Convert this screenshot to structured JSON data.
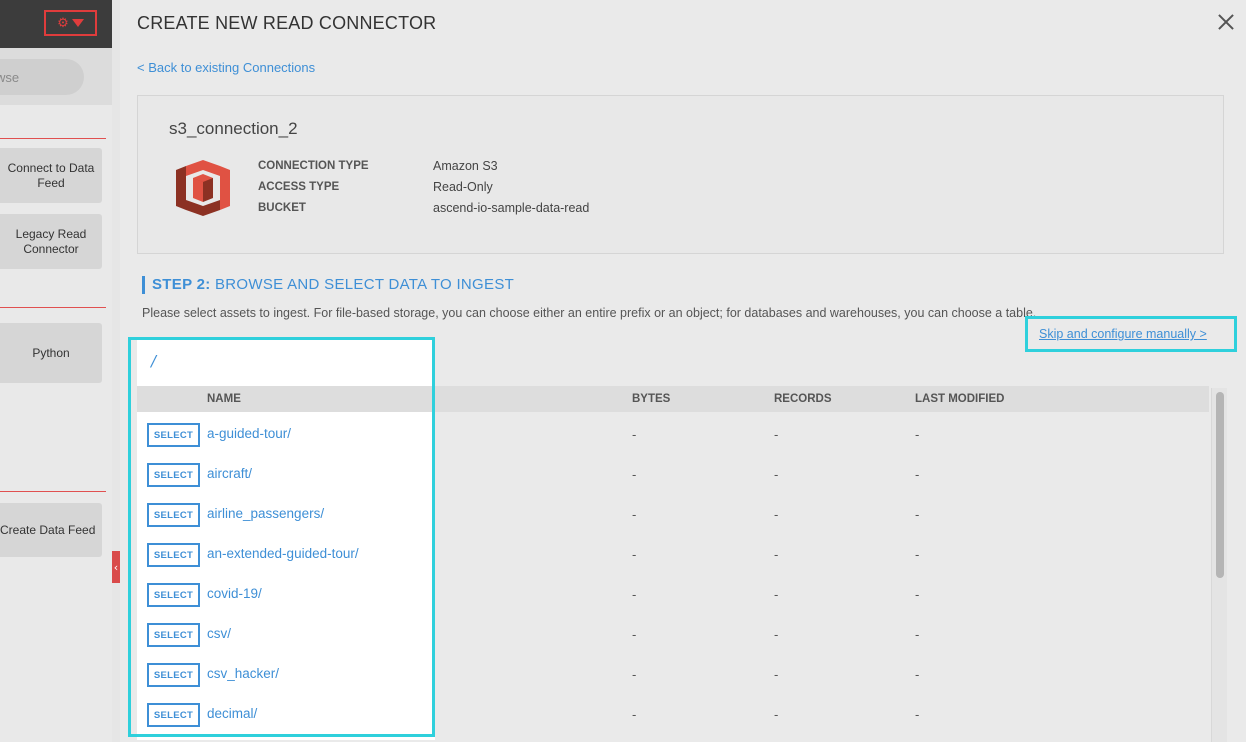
{
  "sidebar": {
    "browse_label": "wse",
    "buttons": {
      "connect": "Connect to Data Feed",
      "legacy": "Legacy Read Connector",
      "python": "Python",
      "create_feed": "Create Data Feed"
    },
    "collapse_glyph": "‹"
  },
  "panel": {
    "title": "CREATE NEW READ CONNECTOR",
    "back_link": "< Back to existing Connections"
  },
  "connection": {
    "name": "s3_connection_2",
    "icon": "amazon-s3-icon",
    "fields": [
      {
        "key": "CONNECTION TYPE",
        "value": "Amazon S3"
      },
      {
        "key": "ACCESS TYPE",
        "value": "Read-Only"
      },
      {
        "key": "BUCKET",
        "value": "ascend-io-sample-data-read"
      }
    ]
  },
  "step": {
    "prefix": "STEP 2:",
    "title": "BROWSE AND SELECT DATA TO INGEST",
    "description": "Please select assets to ingest. For file-based storage, you can choose either an entire prefix or an object; for databases and warehouses, you can choose a table.",
    "skip_link": "Skip and configure manually >"
  },
  "browser": {
    "path": "/",
    "columns": {
      "name": "NAME",
      "bytes": "BYTES",
      "records": "RECORDS",
      "last_modified": "LAST MODIFIED"
    },
    "select_label": "SELECT",
    "rows": [
      {
        "name": "a-guided-tour/",
        "bytes": "-",
        "records": "-",
        "last_modified": "-"
      },
      {
        "name": "aircraft/",
        "bytes": "-",
        "records": "-",
        "last_modified": "-"
      },
      {
        "name": "airline_passengers/",
        "bytes": "-",
        "records": "-",
        "last_modified": "-"
      },
      {
        "name": "an-extended-guided-tour/",
        "bytes": "-",
        "records": "-",
        "last_modified": "-"
      },
      {
        "name": "covid-19/",
        "bytes": "-",
        "records": "-",
        "last_modified": "-"
      },
      {
        "name": "csv/",
        "bytes": "-",
        "records": "-",
        "last_modified": "-"
      },
      {
        "name": "csv_hacker/",
        "bytes": "-",
        "records": "-",
        "last_modified": "-"
      },
      {
        "name": "decimal/",
        "bytes": "-",
        "records": "-",
        "last_modified": "-"
      }
    ]
  },
  "colors": {
    "accent": "#3e8fd6",
    "highlight": "#2fd0dc",
    "danger": "#e03c3c"
  }
}
